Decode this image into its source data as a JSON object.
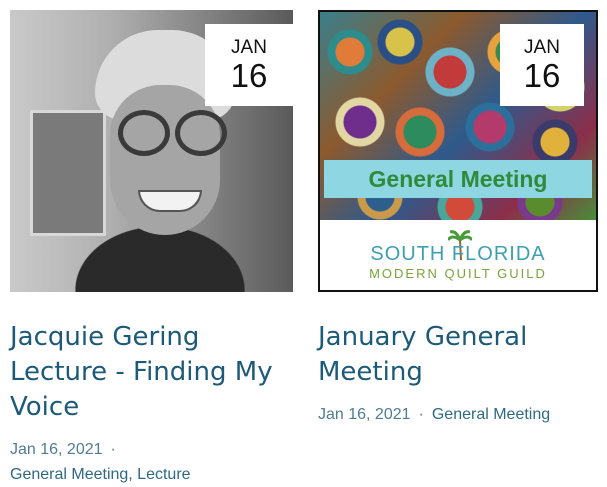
{
  "events": [
    {
      "badge_month": "JAN",
      "badge_day": "16",
      "title": "Jacquie Gering Lecture - Finding My Voice",
      "date": "Jan 16, 2021",
      "separator": "·",
      "categories": "General Meeting, Lecture"
    },
    {
      "badge_month": "JAN",
      "badge_day": "16",
      "title": "January General Meeting",
      "date": "Jan 16, 2021",
      "separator": "·",
      "categories": "General Meeting",
      "poster": {
        "banner_text": "General Meeting",
        "guild_line1": "SOUTH FLORIDA",
        "guild_line2": "MODERN QUILT GUILD"
      }
    }
  ],
  "colors": {
    "title": "#1c5a78",
    "meta": "#2f6a85",
    "banner_bg": "#8fd6e3",
    "banner_text": "#2f8a3a"
  }
}
